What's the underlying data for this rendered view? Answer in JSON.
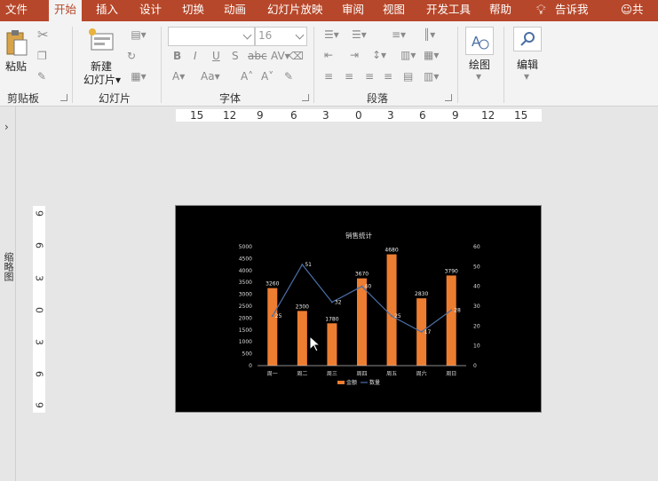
{
  "tabs": [
    "文件",
    "开始",
    "插入",
    "设计",
    "切换",
    "动画",
    "幻灯片放映",
    "审阅",
    "视图",
    "开发工具",
    "帮助",
    "告诉我",
    "共享"
  ],
  "ribbon": {
    "clipboard": {
      "paste": "粘贴",
      "label": "剪贴板"
    },
    "slides": {
      "new_slide_1": "新建",
      "new_slide_2": "幻灯片",
      "label": "幻灯片"
    },
    "font": {
      "size": "16",
      "label": "字体"
    },
    "paragraph": {
      "label": "段落"
    },
    "drawing": {
      "label": "绘图"
    },
    "editing": {
      "label": "编辑"
    }
  },
  "left_pane": {
    "label": "缩略图"
  },
  "hruler": [
    "15",
    "12",
    "9",
    "6",
    "3",
    "0",
    "3",
    "6",
    "9",
    "12",
    "15"
  ],
  "vruler": [
    "9",
    "6",
    "3",
    "0",
    "3",
    "6",
    "9"
  ],
  "chart_data": {
    "type": "bar",
    "title": "销售统计",
    "categories": [
      "周一",
      "周二",
      "周三",
      "周四",
      "周五",
      "周六",
      "周日"
    ],
    "series": [
      {
        "name": "金额",
        "type": "bar",
        "axis": "left",
        "color": "#ed7d31",
        "values": [
          3260,
          2300,
          1780,
          3670,
          4680,
          2830,
          3790
        ]
      },
      {
        "name": "数量",
        "type": "line",
        "axis": "right",
        "color": "#4a6fa5",
        "values": [
          25,
          51,
          32,
          40,
          25,
          17,
          28
        ]
      }
    ],
    "ylim_left": [
      0,
      5000
    ],
    "yticks_left": [
      "0",
      "500",
      "1000",
      "1500",
      "2000",
      "2500",
      "3000",
      "3500",
      "4000",
      "4500",
      "5000"
    ],
    "ylim_right": [
      0,
      60
    ],
    "yticks_right": [
      "0",
      "10",
      "20",
      "30",
      "40",
      "50",
      "60"
    ],
    "legend": "bottom",
    "background": "#000000"
  }
}
